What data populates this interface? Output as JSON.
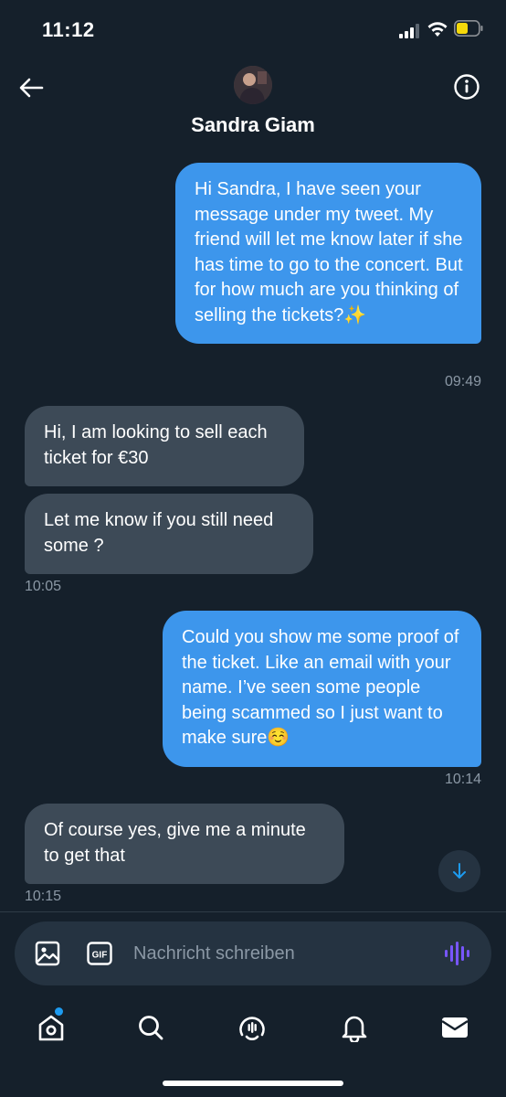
{
  "status_bar": {
    "time": "11:12",
    "battery_color": "#f5d90a"
  },
  "header": {
    "contact_name": "Sandra Giam",
    "back_icon": "arrow-left-icon",
    "info_icon": "info-icon"
  },
  "messages": [
    {
      "direction": "outgoing",
      "text": "Hi Sandra, I have seen your message under my tweet. My friend will let me know later if she has time to go to the concert. But for how much are you thinking of selling the tickets?✨",
      "time": "09:49"
    },
    {
      "direction": "incoming",
      "text": "Hi, I am looking to sell each ticket for €30",
      "time": ""
    },
    {
      "direction": "incoming",
      "text": "Let me know if you still need some ?",
      "time": "10:05"
    },
    {
      "direction": "outgoing",
      "text": "Could you show me some proof of the ticket. Like an email with your name. I’ve seen some people being scammed so I just want to make sure☺️",
      "time": "10:14"
    },
    {
      "direction": "incoming",
      "text": "Of course yes, give me a minute to get that",
      "time": "10:15"
    }
  ],
  "composer": {
    "placeholder": "Nachricht schreiben",
    "gif_label": "GIF",
    "voice_color": "#7856ff"
  },
  "nav": {
    "items": [
      "home-icon",
      "search-icon",
      "spaces-icon",
      "notifications-icon",
      "messages-icon"
    ],
    "accent": "#1d9bf0"
  },
  "colors": {
    "background": "#15202b",
    "outgoing_bubble": "#3d96ec",
    "incoming_bubble": "#3d4a57",
    "timestamp": "#8b98a5"
  }
}
